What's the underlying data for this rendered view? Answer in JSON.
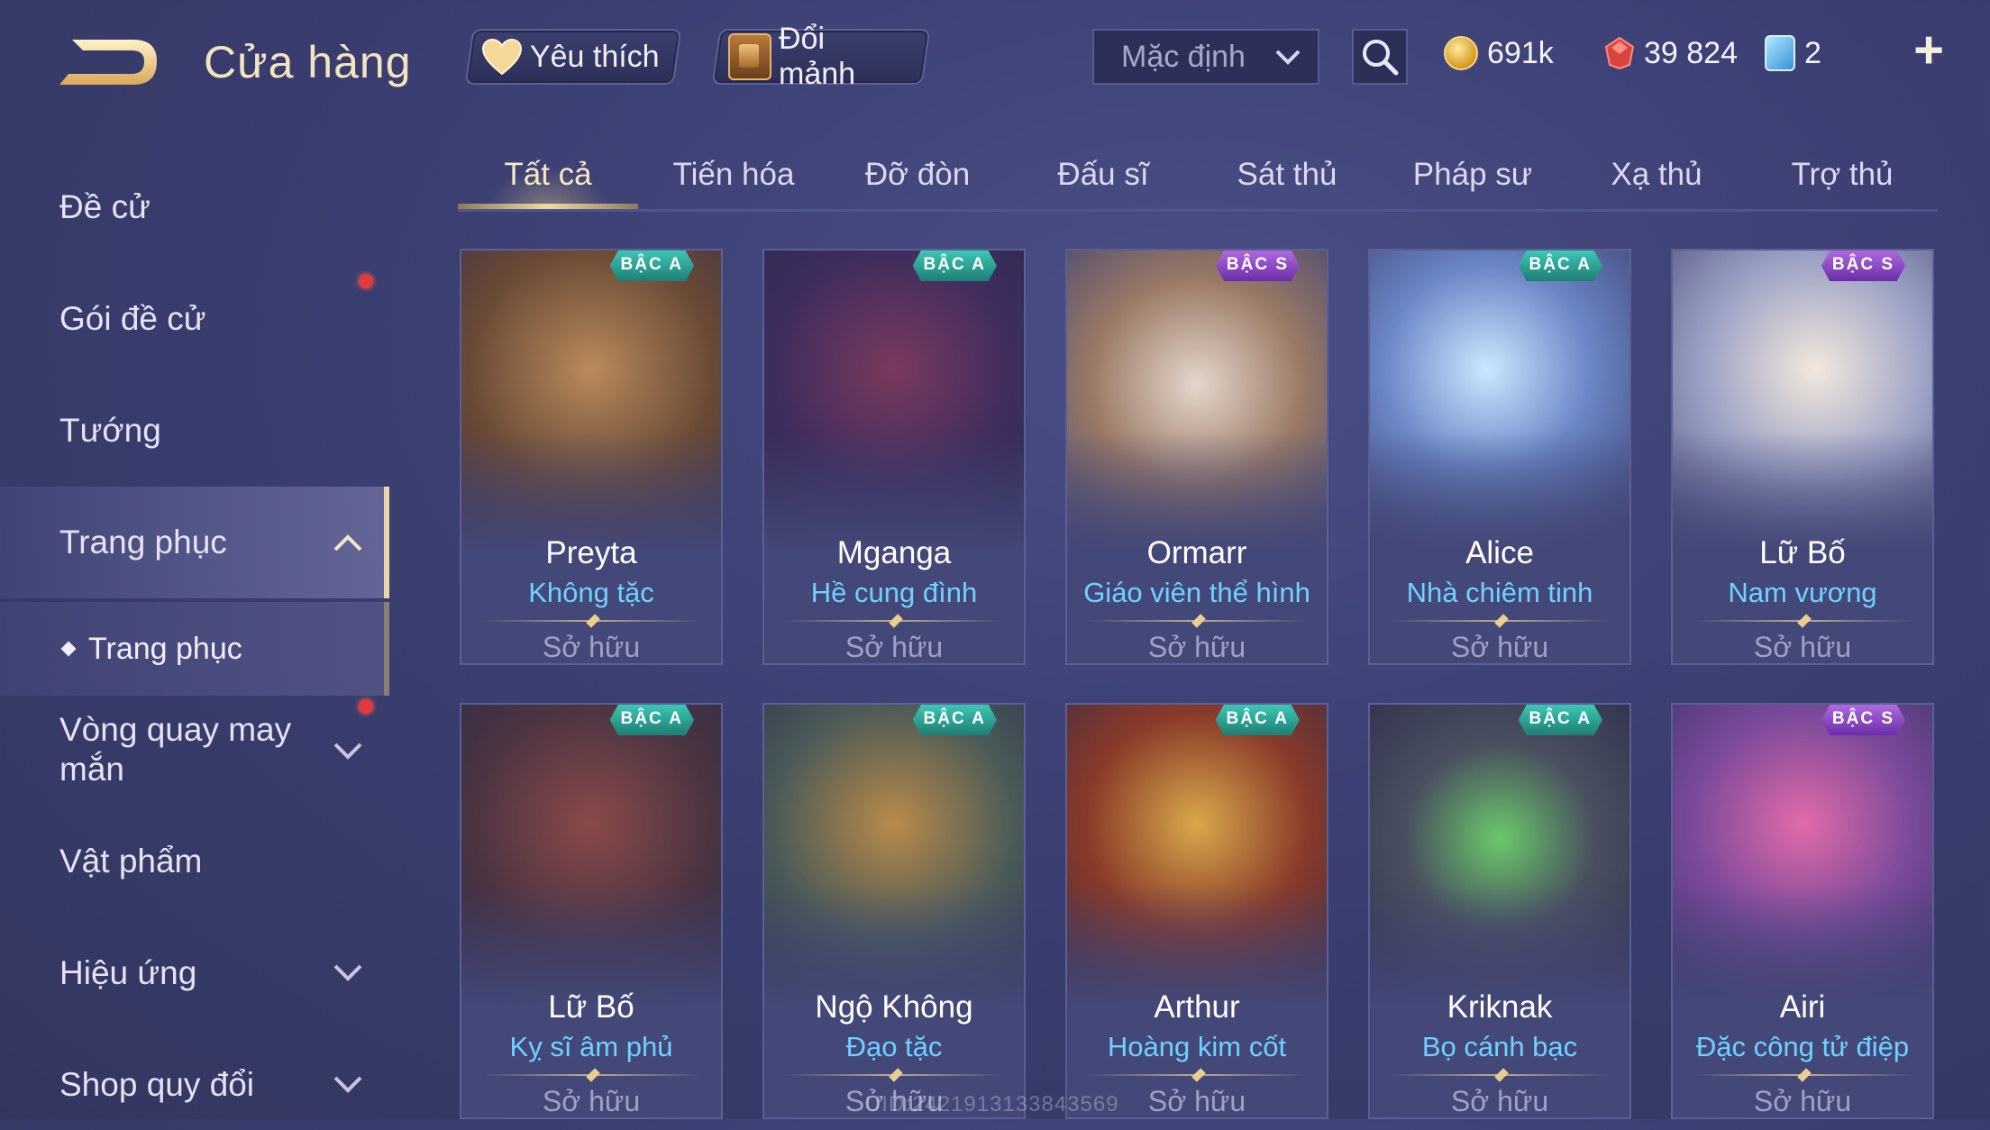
{
  "header": {
    "title": "Cửa hàng",
    "favorites_label": "Yêu thích",
    "exchange_label": "Đổi mảnh",
    "sort_value": "Mặc định",
    "gold": "691k",
    "gems": "39 824",
    "vouchers": "2",
    "add_label": "+"
  },
  "sidebar": {
    "items": [
      {
        "label": "Đề cử"
      },
      {
        "label": "Gói đề cử"
      },
      {
        "label": "Tướng"
      },
      {
        "label": "Trang phục"
      },
      {
        "label": "Trang phục"
      },
      {
        "label": "Vòng quay may mắn"
      },
      {
        "label": "Vật phẩm"
      },
      {
        "label": "Hiệu ứng"
      },
      {
        "label": "Shop quy đổi"
      }
    ]
  },
  "tabs": [
    "Tất cả",
    "Tiến hóa",
    "Đỡ đòn",
    "Đấu sĩ",
    "Sát thủ",
    "Pháp sư",
    "Xạ thủ",
    "Trợ thủ"
  ],
  "cards": [
    {
      "hero": "Preyta",
      "skin": "Không tặc",
      "rank": "BẬC A",
      "status": "Sở hữu"
    },
    {
      "hero": "Mganga",
      "skin": "Hề cung đình",
      "rank": "BẬC A",
      "status": "Sở hữu"
    },
    {
      "hero": "Ormarr",
      "skin": "Giáo viên thể hình",
      "rank": "BẬC S",
      "status": "Sở hữu"
    },
    {
      "hero": "Alice",
      "skin": "Nhà chiêm tinh",
      "rank": "BẬC A",
      "status": "Sở hữu"
    },
    {
      "hero": "Lữ Bố",
      "skin": "Nam vương",
      "rank": "BẬC S",
      "status": "Sở hữu"
    },
    {
      "hero": "Lữ Bố",
      "skin": "Kỵ sĩ âm phủ",
      "rank": "BẬC A",
      "status": "Sở hữu"
    },
    {
      "hero": "Ngộ Không",
      "skin": "Đạo tặc",
      "rank": "BẬC A",
      "status": "Sở hữu"
    },
    {
      "hero": "Arthur",
      "skin": "Hoàng kim cốt",
      "rank": "BẬC A",
      "status": "Sở hữu"
    },
    {
      "hero": "Kriknak",
      "skin": "Bọ cánh bạc",
      "rank": "BẬC A",
      "status": "Sở hữu"
    },
    {
      "hero": "Airi",
      "skin": "Đặc công tử điệp",
      "rank": "BẬC S",
      "status": "Sở hữu"
    }
  ],
  "watermark": "UID:2421913133843569",
  "colors": {
    "background": "#3b3f72",
    "title_gold": "#f4e3c0",
    "skin_name_blue": "#6fd1ff",
    "rank_a": "#2fa898",
    "rank_s": "#8e4ccc",
    "notification_red": "#e23b3b"
  }
}
